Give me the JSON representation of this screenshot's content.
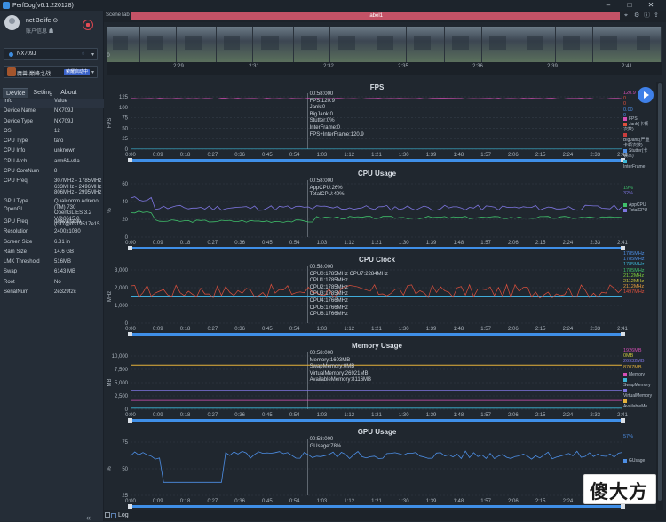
{
  "window": {
    "title": "PerfDog(v6.1.220128)",
    "min": "–",
    "max": "□",
    "close": "✕"
  },
  "user": {
    "name": "net 3elife ⊙",
    "account": "账户信息 ☗"
  },
  "device": {
    "name": "NX709J",
    "icon": "wifi-icon"
  },
  "app": {
    "name": "魔兽·巅峰之战",
    "tag": "荣耀启动中"
  },
  "tabs": [
    "Device",
    "Setting",
    "About"
  ],
  "info": {
    "header": [
      "Info",
      "Value"
    ],
    "rows": [
      [
        "Device Name",
        "NX709J"
      ],
      [
        "Device Type",
        "NX709J"
      ],
      [
        "OS",
        "12"
      ],
      [
        "CPU Type",
        "taro"
      ],
      [
        "CPU Info",
        "unknown"
      ],
      [
        "CPU Arch",
        "arm64-v8a"
      ],
      [
        "CPU CoreNum",
        "8"
      ],
      [
        "CPU Freq",
        "307MHz - 1785MHz\n633MHz - 2496MHz\n806MHz - 2995MHz"
      ],
      [
        "GPU Type",
        "Qualcomm Adreno (TM) 730\nOpenGL ES 3.2 V@0615.0 (GIT@d319517e15"
      ],
      [
        "OpenGL",
        ""
      ],
      [
        "GPU Freq",
        "unavailable"
      ],
      [
        "Resolution",
        "2400x1080"
      ],
      [
        "Screen Size",
        "6.81 in"
      ],
      [
        "Ram Size",
        "14.6 GB"
      ],
      [
        "LMK Threshold",
        "516MB"
      ],
      [
        "Swap",
        "6143 MB"
      ],
      [
        "Root",
        "No"
      ],
      [
        "SerialNum",
        "2e329f2c"
      ]
    ]
  },
  "scene": {
    "tab": "SceneTab",
    "label": "label1"
  },
  "timeline": {
    "ticks": [
      "2:29",
      "2:31",
      "2:32",
      "2:35",
      "2:36",
      "2:39",
      "2:41"
    ],
    "start": "0"
  },
  "xticks": [
    "0:00",
    "0:09",
    "0:18",
    "0:27",
    "0:36",
    "0:45",
    "0:54",
    "1:03",
    "1:12",
    "1:21",
    "1:30",
    "1:39",
    "1:48",
    "1:57",
    "2:06",
    "2:15",
    "2:24",
    "2:33",
    "2:41"
  ],
  "charts": {
    "fps": {
      "title": "FPS",
      "ylabel": "FPS",
      "yticks": [
        "125",
        "100",
        "75",
        "50",
        "25",
        "0"
      ],
      "tooltip": [
        "00:58:000",
        "FPS:120.9",
        "Jank:0",
        "BigJank:0",
        "Stutter:0%",
        "InterFrame:0",
        "FPS+InterFrame:120.9"
      ],
      "right_values": [
        {
          "v": "120.9",
          "c": "#d54fb5"
        },
        {
          "v": "0",
          "c": "#e0503c"
        },
        {
          "v": "0",
          "c": "#e0503c"
        },
        {
          "v": "0.00",
          "c": "#4d8fe6"
        },
        {
          "v": "0",
          "c": "#4d8fe6"
        }
      ],
      "legend": [
        {
          "n": "FPS",
          "c": "#d54fb5"
        },
        {
          "n": "Jank(卡顿次数)",
          "c": "#e0503c"
        },
        {
          "n": "BigJank(严重卡顿次数)",
          "c": "#c93d3d"
        },
        {
          "n": "Stutter(卡顿率)",
          "c": "#4d8fe6"
        },
        {
          "n": "InterFrame",
          "c": "#3cb6d6"
        }
      ]
    },
    "cpu": {
      "title": "CPU Usage",
      "ylabel": "%",
      "yticks": [
        "60",
        "40",
        "20",
        "0"
      ],
      "tooltip": [
        "00:58:000",
        "AppCPU:26%",
        "TotalCPU:40%"
      ],
      "right_values": [
        {
          "v": "19%",
          "c": "#3fbf6a"
        },
        {
          "v": "32%",
          "c": "#7d75e0"
        }
      ],
      "legend": [
        {
          "n": "AppCPU",
          "c": "#3fbf6a"
        },
        {
          "n": "TotalCPU",
          "c": "#7d75e0"
        }
      ]
    },
    "clock": {
      "title": "CPU Clock",
      "ylabel": "MHz",
      "yticks": [
        "3,000",
        "2,000",
        "1,000",
        "0"
      ],
      "tooltip": [
        "00:58:000",
        "CPU0:1785MHz CPU7:2284MHz",
        "CPU1:1785MHz",
        "CPU2:1785MHz",
        "CPU3:1785MHz",
        "CPU4:1766MHz",
        "CPU5:1766MHz",
        "CPU6:1766MHz"
      ],
      "right_values": [
        {
          "v": "1785MHz",
          "c": "#4d8fe6"
        },
        {
          "v": "1785MHz",
          "c": "#4d8fe6"
        },
        {
          "v": "1785MHz",
          "c": "#3cb6d6"
        },
        {
          "v": "1785MHz",
          "c": "#3fbf6a"
        },
        {
          "v": "2112MHz",
          "c": "#7fcf3a"
        },
        {
          "v": "2112MHz",
          "c": "#c7c33b"
        },
        {
          "v": "2112MHz",
          "c": "#e59a3a"
        },
        {
          "v": "1497MHz",
          "c": "#e0503c"
        }
      ]
    },
    "memory": {
      "title": "Memory Usage",
      "ylabel": "MB",
      "yticks": [
        "10,000",
        "7,500",
        "5,000",
        "2,500",
        "0"
      ],
      "tooltip": [
        "00:58:000",
        "Memory:1603MB",
        "SwapMemory:0MB",
        "VirtualMemory:26921MB",
        "AvailableMemory:8116MB"
      ],
      "right_values": [
        {
          "v": "1926MB",
          "c": "#d54fb5"
        },
        {
          "v": "0MB",
          "c": "#c7c33b"
        },
        {
          "v": "26932MB",
          "c": "#7d75e0"
        },
        {
          "v": "8707MB",
          "c": "#e5b23a"
        }
      ],
      "legend": [
        {
          "n": "Memory",
          "c": "#d54fb5"
        },
        {
          "n": "SwapMemory",
          "c": "#3cb6d6"
        },
        {
          "n": "VirtualMemory",
          "c": "#7d75e0"
        },
        {
          "n": "AvailableMe...",
          "c": "#e5b23a"
        }
      ]
    },
    "gpu": {
      "title": "GPU Usage",
      "ylabel": "%",
      "yticks": [
        "75",
        "50",
        "25"
      ],
      "tooltip": [
        "00:58:000",
        "GUsage:78%"
      ],
      "right_values": [
        {
          "v": "57%",
          "c": "#4d8fe6"
        }
      ],
      "legend": [
        {
          "n": "GUsage",
          "c": "#4d8fe6"
        }
      ]
    }
  },
  "bottom": {
    "log": "Log"
  },
  "watermark": "傻大方"
}
